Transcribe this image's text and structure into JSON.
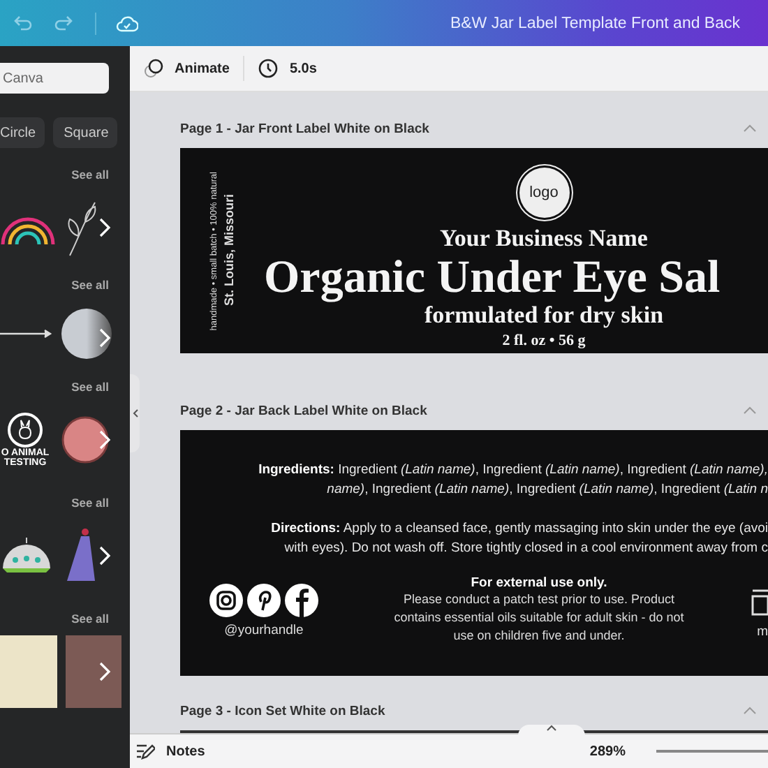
{
  "top_bar": {
    "title": "B&W Jar Label Template Front and Back"
  },
  "sidebar": {
    "search": {
      "value": "Canva"
    },
    "chips": [
      {
        "label": "Circle"
      },
      {
        "label": "Square"
      }
    ],
    "sections": [
      {
        "link": "See all",
        "kind": "graphics"
      },
      {
        "link": "See all",
        "kind": "shapes"
      },
      {
        "link": "See all",
        "kind": "stickers",
        "sticker_text": [
          "O ANIMAL",
          "TESTING"
        ]
      },
      {
        "link": "See all",
        "kind": "illustrations"
      },
      {
        "link": "See all",
        "kind": "photos"
      }
    ]
  },
  "toolbar": {
    "animate": "Animate",
    "duration": "5.0s"
  },
  "pages": [
    {
      "kind": "front",
      "title": "Page 1 - Jar Front Label White on Black",
      "side_lines": [
        "handmade • small batch • 100% natural",
        "St. Louis, Missouri"
      ],
      "logo": "logo",
      "business": "Your Business Name",
      "product": "Organic Under Eye Sal",
      "subtitle": "formulated for dry skin",
      "size": "2 fl. oz • 56 g"
    },
    {
      "kind": "back",
      "title": "Page 2 - Jar Back Label White on Black",
      "lines": [
        "**Ingredients:** Ingredient *(Latin name)*, Ingredient *(Latin name)*, Ingredient *(Latin name),*",
        "*name)*, Ingredient *(Latin name)*, Ingredient *(Latin name)*, Ingredient *(Latin n*",
        "**Directions:** Apply to a cleansed face, gently massaging into skin under the eye (avoi",
        "with eyes). Do not wash off. Store tightly closed in a cool environment away from c"
      ],
      "handle": "@yourhandle",
      "warning_title": "For external use only.",
      "warning": "Please conduct a patch test prior to use. Product contains essential oils suitable for adult skin - do not use on children five and under.",
      "cut_text": "m"
    },
    {
      "kind": "collapsed",
      "title": "Page 3 - Icon Set White on Black"
    }
  ],
  "bottom_bar": {
    "notes": "Notes",
    "zoom": "289%"
  }
}
